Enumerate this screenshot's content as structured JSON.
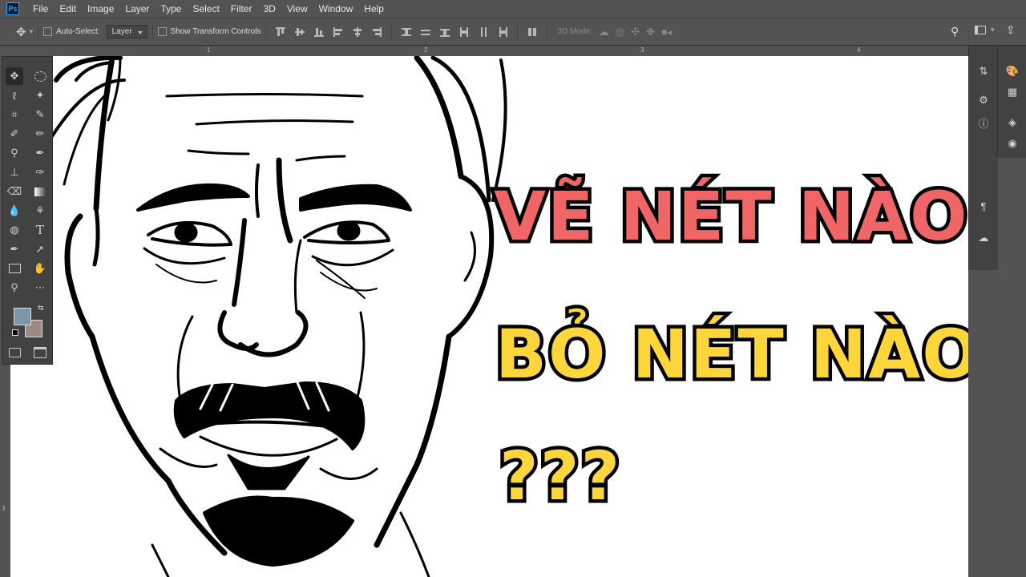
{
  "app": {
    "logo": "Ps"
  },
  "menu": [
    "File",
    "Edit",
    "Image",
    "Layer",
    "Type",
    "Select",
    "Filter",
    "3D",
    "View",
    "Window",
    "Help"
  ],
  "options": {
    "auto_select_label": "Auto-Select:",
    "auto_select_value": "Layer",
    "show_transform_label": "Show Transform Controls",
    "mode_3d_label": "3D Mode:"
  },
  "ruler": {
    "ticks": [
      "1",
      "2",
      "3",
      "4"
    ]
  },
  "left_ruler": {
    "ticks": [
      "3"
    ]
  },
  "colors": {
    "foreground": "#7a97a7",
    "background": "#9c8a85"
  },
  "overlay": {
    "line1": "VẼ NÉT NÀO",
    "line2": "BỎ NÉT NÀO",
    "line3": "???",
    "line1_color": "#f06565",
    "line2_color": "#fdd63c",
    "line3_color": "#fdd63c"
  },
  "icons": [
    "move-tool-icon",
    "marquee-icon",
    "lasso-icon",
    "magic-wand-icon",
    "crop-icon",
    "eyedropper-icon",
    "spot-heal-icon",
    "brush-icon",
    "clone-stamp-icon",
    "history-brush-icon",
    "eraser-icon",
    "gradient-icon",
    "blur-icon",
    "dodge-icon",
    "pen-icon",
    "type-icon",
    "path-select-icon",
    "hand-icon",
    "rectangle-icon",
    "more-icon",
    "zoom-icon",
    "swap-icon",
    "quick-mask-icon",
    "screen-mode-icon",
    "search-icon",
    "workspace-icon",
    "share-icon"
  ]
}
